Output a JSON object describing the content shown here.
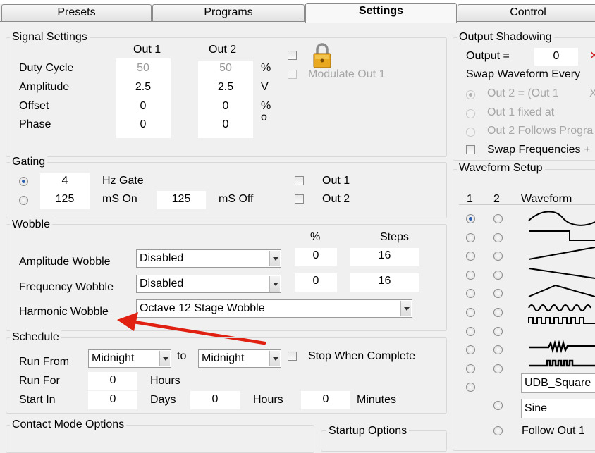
{
  "tabs": [
    "Presets",
    "Programs",
    "Settings",
    "Control"
  ],
  "signal": {
    "title": "Signal Settings",
    "col1": "Out 1",
    "col2": "Out 2",
    "rows": [
      {
        "label": "Duty Cycle",
        "out1": "50",
        "out2": "50",
        "unit": "%"
      },
      {
        "label": "Amplitude",
        "out1": "2.5",
        "out2": "2.5",
        "unit": "V"
      },
      {
        "label": "Offset",
        "out1": "0",
        "out2": "0",
        "unit": "%"
      },
      {
        "label": "Phase",
        "out1": "0",
        "out2": "0",
        "unit": "o"
      }
    ],
    "modulate_label": "Modulate Out 1"
  },
  "gating": {
    "title": "Gating",
    "hz_value": "4",
    "hz_label": "Hz Gate",
    "on_value": "125",
    "on_label": "mS On",
    "off_value": "125",
    "off_label": "mS Off",
    "out1": "Out 1",
    "out2": "Out 2"
  },
  "wobble": {
    "title": "Wobble",
    "pct_header": "%",
    "steps_header": "Steps",
    "amp_label": "Amplitude Wobble",
    "amp_select": "Disabled",
    "amp_pct": "0",
    "amp_steps": "16",
    "freq_label": "Frequency Wobble",
    "freq_select": "Disabled",
    "freq_pct": "0",
    "freq_steps": "16",
    "harm_label": "Harmonic Wobble",
    "harm_select": "Octave 12 Stage Wobble"
  },
  "schedule": {
    "title": "Schedule",
    "run_from": "Run From",
    "from_select": "Midnight",
    "to": "to",
    "to_select": "Midnight",
    "stop_label": "Stop When Complete",
    "run_for": "Run For",
    "run_for_value": "0",
    "hours": "Hours",
    "start_in": "Start In",
    "days_value": "0",
    "days": "Days",
    "hours_value": "0",
    "hours2": "Hours",
    "minutes_value": "0",
    "minutes": "Minutes"
  },
  "contact_title": "Contact Mode Options",
  "startup_title": "Startup Options",
  "shadow": {
    "title": "Output Shadowing",
    "output_label": "Output =",
    "output_value": "0",
    "swap_every": "Swap Waveform Every",
    "opt1": "Out 2 = (Out 1",
    "opt2": "Out 1 fixed at",
    "opt3": "Out 2 Follows Progra",
    "swap_freq": "Swap Frequencies +"
  },
  "waveform": {
    "title": "Waveform Setup",
    "col1": "1",
    "col2": "2",
    "col3": "Waveform",
    "udb": "UDB_Square",
    "sine": "Sine",
    "follow": "Follow Out 1"
  },
  "icons": {
    "lock": "padlock-icon",
    "close": "close-icon"
  },
  "colors": {
    "arrow": "#e02010",
    "accent": "#2a5fb0"
  }
}
